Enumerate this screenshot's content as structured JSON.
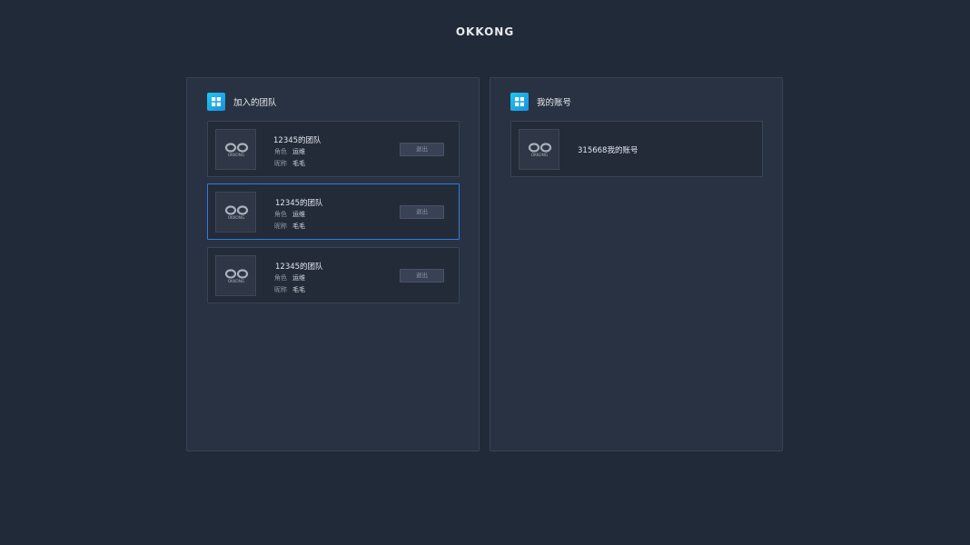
{
  "brand": "OKKONG",
  "left_panel": {
    "title": "加入的团队",
    "icon": "grid-icon",
    "teams": [
      {
        "name": "12345的团队",
        "role_label": "角色",
        "role": "运维",
        "nick_label": "昵称",
        "nick": "毛毛",
        "exit_label": "退出",
        "logo_text": "OKKONG",
        "selected": false
      },
      {
        "name": "12345的团队",
        "role_label": "角色",
        "role": "运维",
        "nick_label": "昵称",
        "nick": "毛毛",
        "exit_label": "退出",
        "logo_text": "OKKONG",
        "selected": true
      },
      {
        "name": "12345的团队",
        "role_label": "角色",
        "role": "运维",
        "nick_label": "昵称",
        "nick": "毛毛",
        "exit_label": "退出",
        "logo_text": "OKKONG",
        "selected": false
      }
    ]
  },
  "right_panel": {
    "title": "我的账号",
    "icon": "grid-icon",
    "account": {
      "name": "315668我的账号",
      "logo_text": "OKKONG"
    }
  },
  "colors": {
    "background": "#212a39",
    "panel": "#293242",
    "accent": "#2c7de0",
    "icon_gradient_start": "#1fc6ee",
    "icon_gradient_end": "#1a8fe0"
  }
}
